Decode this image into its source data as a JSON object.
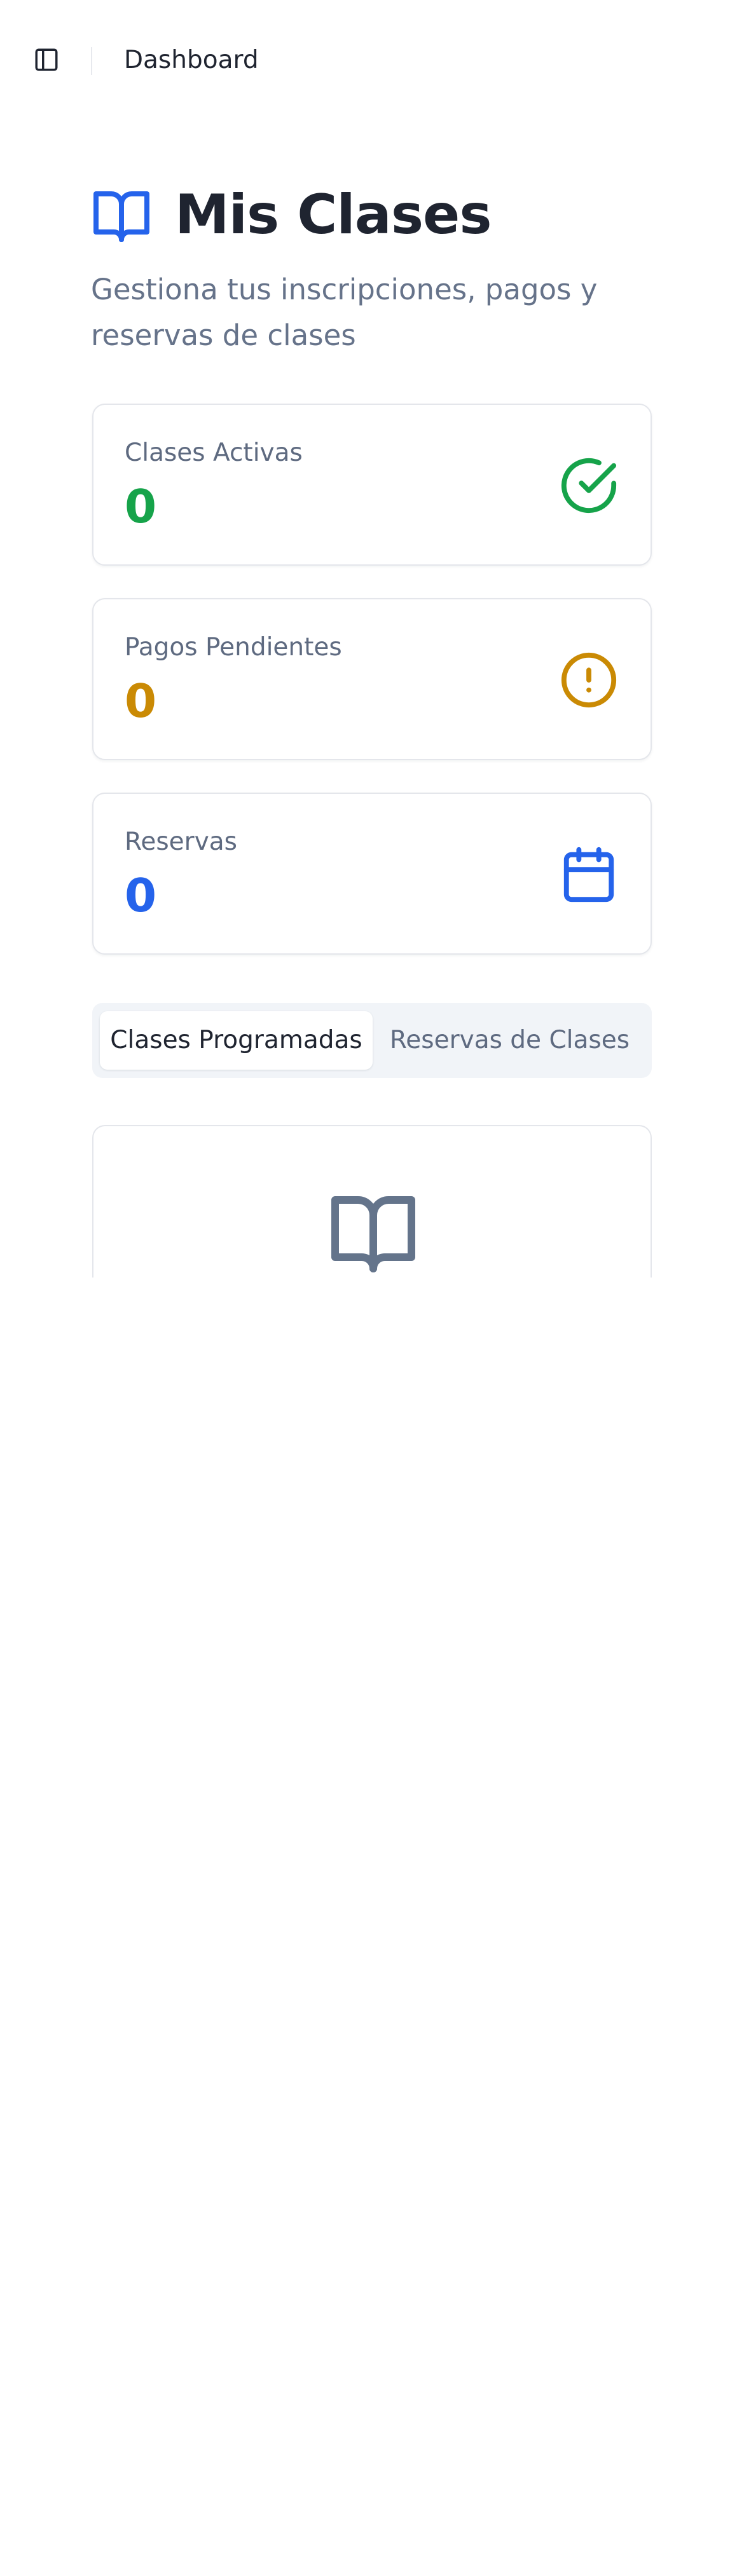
{
  "topbar": {
    "toggle_icon": "sidebar-toggle-icon",
    "breadcrumb": "Dashboard"
  },
  "header": {
    "icon": "book-open-icon",
    "title": "Mis Clases",
    "subtitle": "Gestiona tus inscripciones, pagos y reservas de clases"
  },
  "stats": [
    {
      "label": "Clases Activas",
      "value": "0",
      "icon": "check-circle-icon",
      "color": "#16a34a"
    },
    {
      "label": "Pagos Pendientes",
      "value": "0",
      "icon": "alert-circle-icon",
      "color": "#ca8a04"
    },
    {
      "label": "Reservas",
      "value": "0",
      "icon": "calendar-icon",
      "color": "#2563eb"
    }
  ],
  "tabs": [
    {
      "label": "Clases Programadas",
      "active": true
    },
    {
      "label": "Reservas de Clases",
      "active": false
    }
  ],
  "empty_state": {
    "icon": "book-open-icon"
  },
  "colors": {
    "accent": "#2563eb",
    "muted_text": "#66738a",
    "icon_gray": "#64748b"
  }
}
